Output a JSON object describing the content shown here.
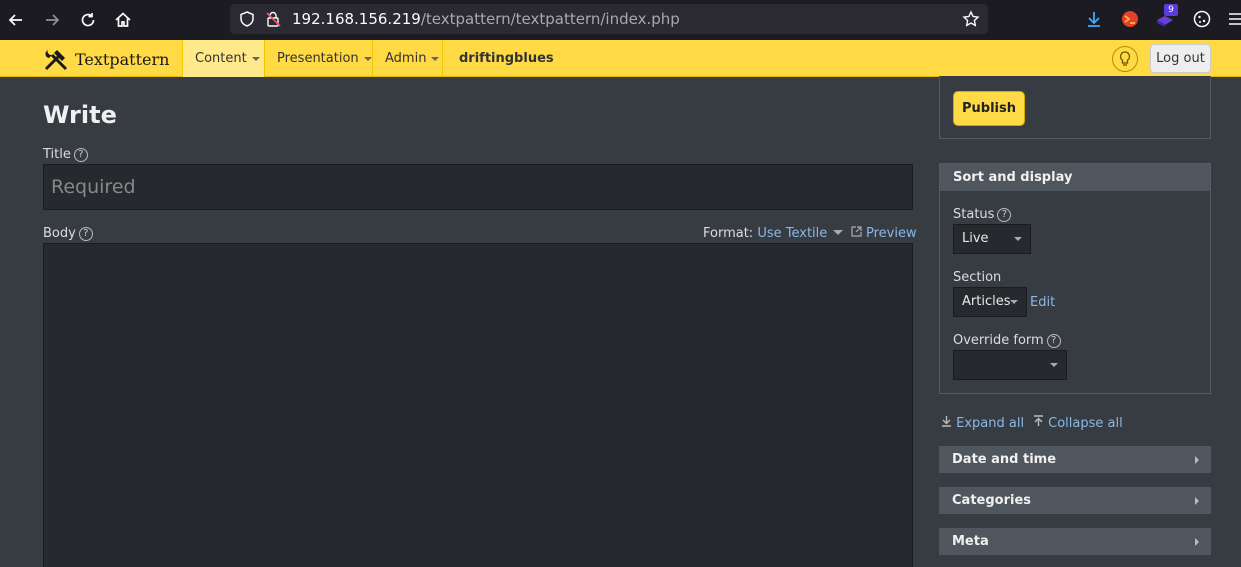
{
  "browser": {
    "url_host": "192.168.156.219",
    "url_path": "/textpattern/textpattern/index.php",
    "extension_badge": "9"
  },
  "header": {
    "logo_text": "Textpattern",
    "nav": [
      {
        "label": "Content"
      },
      {
        "label": "Presentation"
      },
      {
        "label": "Admin"
      }
    ],
    "site_name": "driftingblues",
    "logout_label": "Log out"
  },
  "main": {
    "page_title": "Write",
    "title_label": "Title",
    "title_placeholder": "Required",
    "body_label": "Body",
    "format_label": "Format:",
    "format_value": "Use Textile",
    "preview_label": "Preview",
    "help_glyph": "?"
  },
  "sidebar": {
    "publish_label": "Publish",
    "sort_display": {
      "heading": "Sort and display",
      "status_label": "Status",
      "status_value": "Live",
      "section_label": "Section",
      "section_value": "Articles",
      "section_edit": "Edit",
      "override_label": "Override form",
      "override_value": ""
    },
    "expand_all": "Expand all",
    "collapse_all": "Collapse all",
    "panels": [
      {
        "heading": "Date and time"
      },
      {
        "heading": "Categories"
      },
      {
        "heading": "Meta"
      }
    ]
  },
  "colors": {
    "accent": "#ffda44",
    "link": "#8ab8e6",
    "background": "#373c43"
  }
}
